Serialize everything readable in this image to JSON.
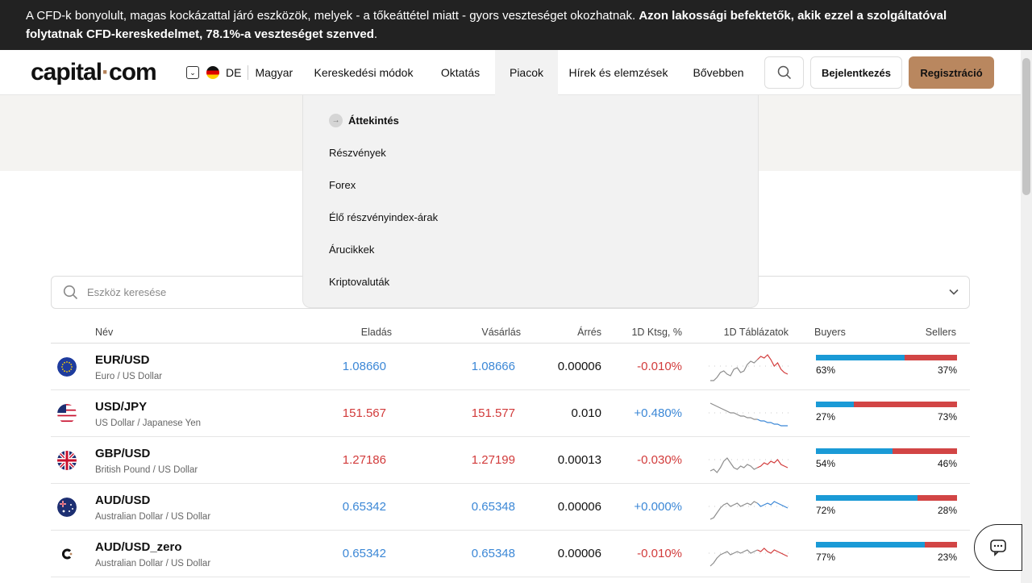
{
  "warning": {
    "text": "A CFD-k bonyolult, magas kockázattal járó eszközök, melyek - a tőkeáttétel miatt - gyors veszteséget okozhatnak. ",
    "bold": "Azon lakossági befektetők, akik ezzel a szolgáltatóval folytatnak CFD-kereskedelmet, 78.1%-a veszteséget szenved",
    "end": "."
  },
  "header": {
    "logo_main": "capital",
    "logo_dot": "·",
    "logo_end": "com",
    "lang_code": "DE",
    "lang_name": "Magyar",
    "menu": [
      "Kereskedési módok",
      "Oktatás",
      "Piacok",
      "Hírek és elemzések",
      "Bővebben"
    ],
    "login": "Bejelentkezés",
    "register": "Regisztráció"
  },
  "dropdown": {
    "overview": "Áttekintés",
    "items": [
      "Részvények",
      "Forex",
      "Élő részvényindex-árak",
      "Árucikkek",
      "Kriptovaluták"
    ]
  },
  "search": {
    "placeholder": "Eszköz keresése"
  },
  "table": {
    "headers": {
      "name": "Név",
      "sell": "Eladás",
      "buy": "Vásárlás",
      "spread": "Árrés",
      "change": "1D Ktsg, %",
      "charts": "1D Táblázatok",
      "buyers": "Buyers",
      "sellers": "Sellers"
    },
    "rows": [
      {
        "symbol": "EUR/USD",
        "desc": "Euro / US Dollar",
        "sell": "1.08660",
        "buy": "1.08666",
        "spread": "0.00006",
        "change": "-0.010%",
        "price_color": "#3b87d6",
        "change_color": "#d23b3b",
        "buyers": "63%",
        "sellers": "37%",
        "buyers_share": 0.63,
        "flag": "eu"
      },
      {
        "symbol": "USD/JPY",
        "desc": "US Dollar / Japanese Yen",
        "sell": "151.567",
        "buy": "151.577",
        "spread": "0.010",
        "change": "+0.480%",
        "price_color": "#d23b3b",
        "change_color": "#3b87d6",
        "buyers": "27%",
        "sellers": "73%",
        "buyers_share": 0.27,
        "flag": "us"
      },
      {
        "symbol": "GBP/USD",
        "desc": "British Pound / US Dollar",
        "sell": "1.27186",
        "buy": "1.27199",
        "spread": "0.00013",
        "change": "-0.030%",
        "price_color": "#d23b3b",
        "change_color": "#d23b3b",
        "buyers": "54%",
        "sellers": "46%",
        "buyers_share": 0.54,
        "flag": "gb"
      },
      {
        "symbol": "AUD/USD",
        "desc": "Australian Dollar / US Dollar",
        "sell": "0.65342",
        "buy": "0.65348",
        "spread": "0.00006",
        "change": "+0.000%",
        "price_color": "#3b87d6",
        "change_color": "#3b87d6",
        "buyers": "72%",
        "sellers": "28%",
        "buyers_share": 0.72,
        "flag": "au"
      },
      {
        "symbol": "AUD/USD_zero",
        "desc": "Australian Dollar / US Dollar",
        "sell": "0.65342",
        "buy": "0.65348",
        "spread": "0.00006",
        "change": "-0.010%",
        "price_color": "#3b87d6",
        "change_color": "#d23b3b",
        "buyers": "77%",
        "sellers": "23%",
        "buyers_share": 0.77,
        "flag": "capital"
      }
    ]
  },
  "colors": {
    "accent": "#b9875f",
    "buyers": "#1a9ad6",
    "sellers": "#d24545",
    "up": "#3b87d6",
    "down": "#d23b3b"
  }
}
